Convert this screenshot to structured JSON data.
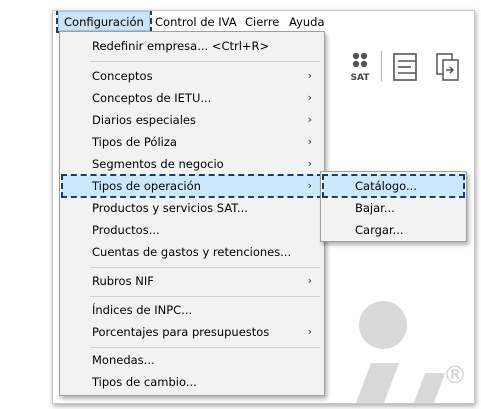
{
  "menubar": {
    "items": [
      {
        "label": "Configuración",
        "active": true
      },
      {
        "label": "Control de IVA"
      },
      {
        "label": "Cierre"
      },
      {
        "label": "Ayuda"
      }
    ]
  },
  "toolbar": {
    "sat_label": "SAT",
    "icons": [
      "sat-icon",
      "document-lines-icon",
      "transfer-doc-icon"
    ]
  },
  "logo": {
    "registered": "®",
    "icon": "app-logo"
  },
  "config_menu": {
    "items": [
      {
        "label": "Redefinir empresa... <Ctrl+R>",
        "submenu": false
      },
      {
        "label": "Conceptos",
        "submenu": true
      },
      {
        "label": "Conceptos de IETU...",
        "submenu": true
      },
      {
        "label": "Diarios especiales",
        "submenu": true
      },
      {
        "label": "Tipos de Póliza",
        "submenu": true
      },
      {
        "label": "Segmentos de negocio",
        "submenu": true
      },
      {
        "label": "Tipos de operación",
        "submenu": true,
        "highlighted": true
      },
      {
        "label": "Productos y servicios SAT...",
        "submenu": false
      },
      {
        "label": "Productos...",
        "submenu": false
      },
      {
        "label": "Cuentas de gastos y retenciones...",
        "submenu": false
      },
      {
        "label": "Rubros NIF",
        "submenu": true
      },
      {
        "label": "Índices de INPC...",
        "submenu": false
      },
      {
        "label": "Porcentajes para presupuestos",
        "submenu": true
      },
      {
        "label": "Monedas...",
        "submenu": false
      },
      {
        "label": "Tipos de cambio...",
        "submenu": false
      }
    ],
    "arrow_glyph": "›"
  },
  "tipos_operacion_submenu": {
    "items": [
      {
        "label": "Catálogo...",
        "highlighted": true
      },
      {
        "label": "Bajar..."
      },
      {
        "label": "Cargar..."
      }
    ]
  },
  "colors": {
    "highlight_bg": "#cce8ff",
    "dashed_outline": "#1b3f66",
    "menu_bg": "#f2f2f2",
    "logo_gray": "#d9d9d9"
  }
}
